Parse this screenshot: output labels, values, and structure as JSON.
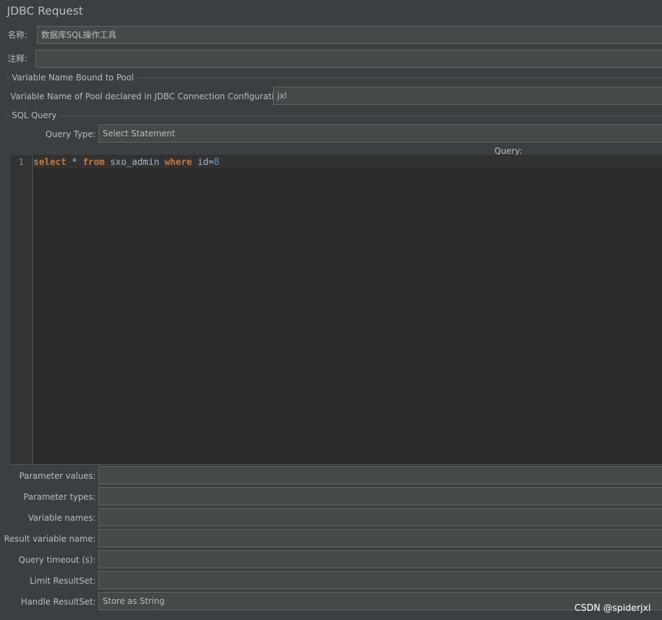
{
  "panel": {
    "title": "JDBC Request"
  },
  "name_field": {
    "label": "名称:",
    "value": "数据库SQL操作工具"
  },
  "comment_field": {
    "label": "注释:",
    "value": ""
  },
  "pool_group": {
    "title": "Variable Name Bound to Pool",
    "pool_label": "Variable Name of Pool declared in JDBC Connection Configuration:",
    "pool_value": "jxl"
  },
  "sql_group": {
    "title": "SQL Query",
    "query_type_label": "Query Type:",
    "query_type_value": "Select Statement",
    "query_label": "Query:"
  },
  "editor": {
    "line_number": "1",
    "tokens": {
      "kw_select": "select",
      "t_star": " * ",
      "kw_from": "from",
      "t_table": " sxo_admin ",
      "kw_where": "where",
      "t_cond": " id=",
      "n_value": "8"
    }
  },
  "params": {
    "parameter_values": {
      "label": "Parameter values:",
      "value": ""
    },
    "parameter_types": {
      "label": "Parameter types:",
      "value": ""
    },
    "variable_names": {
      "label": "Variable names:",
      "value": ""
    },
    "result_variable_name": {
      "label": "Result variable name:",
      "value": ""
    },
    "query_timeout": {
      "label": "Query timeout (s):",
      "value": ""
    },
    "limit_resultset": {
      "label": "Limit ResultSet:",
      "value": ""
    },
    "handle_resultset": {
      "label": "Handle ResultSet:",
      "value": "Store as String"
    }
  },
  "watermark": {
    "text": "CSDN @spiderjxl"
  },
  "colors": {
    "background": "#3c3f41",
    "field_background": "#45494a",
    "editor_background": "#2b2b2b",
    "keyword": "#cc7832",
    "number": "#6897bb",
    "text": "#bbbbbb"
  }
}
